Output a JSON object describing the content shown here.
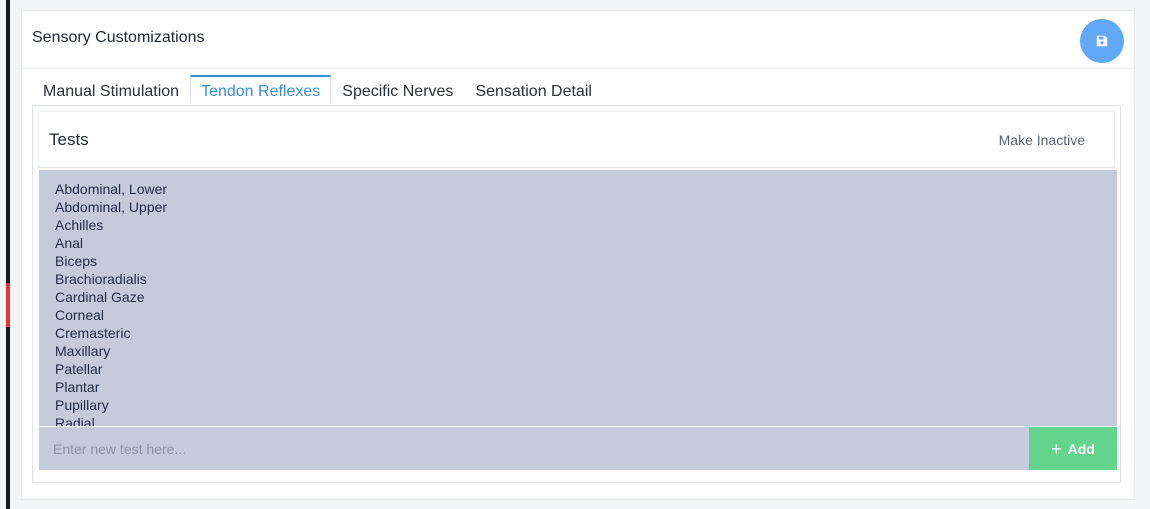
{
  "card": {
    "title": "Sensory Customizations"
  },
  "tabs": [
    {
      "label": "Manual Stimulation",
      "active": false
    },
    {
      "label": "Tendon Reflexes",
      "active": true
    },
    {
      "label": "Specific Nerves",
      "active": false
    },
    {
      "label": "Sensation Detail",
      "active": false
    }
  ],
  "tests": {
    "title": "Tests",
    "make_inactive_label": "Make Inactive",
    "items": [
      "Abdominal, Lower",
      "Abdominal, Upper",
      "Achilles",
      "Anal",
      "Biceps",
      "Brachioradialis",
      "Cardinal Gaze",
      "Corneal",
      "Cremasteric",
      "Maxillary",
      "Patellar",
      "Plantar",
      "Pupillary",
      "Radial"
    ],
    "new_test_placeholder": "Enter new test here...",
    "new_test_value": "",
    "add_label": "Add"
  },
  "icons": {
    "save": "save-floppy-icon",
    "add": "plus-icon"
  },
  "colors": {
    "accent_blue": "#3a8fd9",
    "save_button": "#62a8f8",
    "add_button": "#63d48c",
    "list_background": "#c5cbdb",
    "rail_accent": "#e8323c"
  }
}
